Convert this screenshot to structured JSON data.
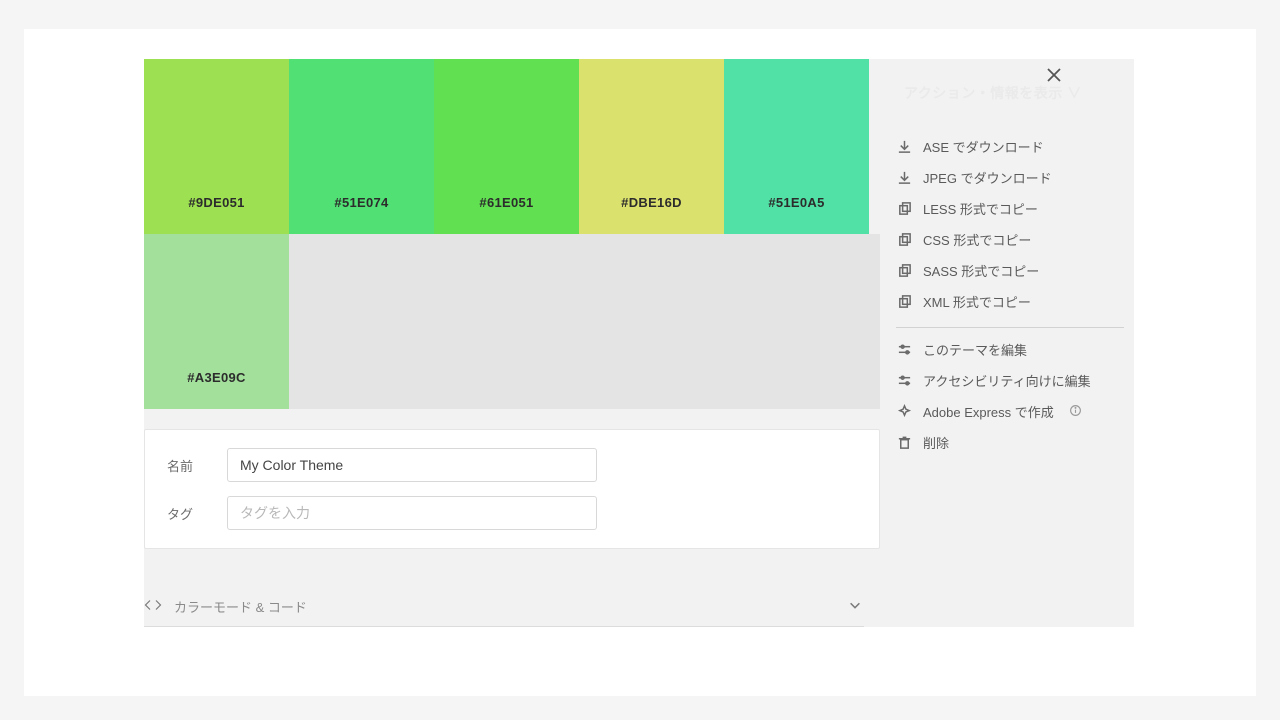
{
  "ghost_header": "アクション・情報を表示 ∨",
  "swatches_row1": [
    {
      "hex": "#9DE051",
      "label": "#9DE051"
    },
    {
      "hex": "#51E074",
      "label": "#51E074"
    },
    {
      "hex": "#61E051",
      "label": "#61E051"
    },
    {
      "hex": "#DBE16D",
      "label": "#DBE16D"
    },
    {
      "hex": "#51E0A5",
      "label": "#51E0A5"
    }
  ],
  "swatches_row2": [
    {
      "hex": "#A3E09C",
      "label": "#A3E09C"
    }
  ],
  "form": {
    "name_label": "名前",
    "name_value": "My Color Theme",
    "tag_label": "タグ",
    "tag_placeholder": "タグを入力"
  },
  "menu": {
    "download_ase": "ASE でダウンロード",
    "download_jpeg": "JPEG でダウンロード",
    "copy_less": "LESS 形式でコピー",
    "copy_css": "CSS 形式でコピー",
    "copy_sass": "SASS 形式でコピー",
    "copy_xml": "XML 形式でコピー",
    "edit_theme": "このテーマを編集",
    "edit_accessibility": "アクセシビリティ向けに編集",
    "create_express": "Adobe Express で作成",
    "delete": "削除"
  },
  "bottom": {
    "label": "カラーモード & コード"
  }
}
